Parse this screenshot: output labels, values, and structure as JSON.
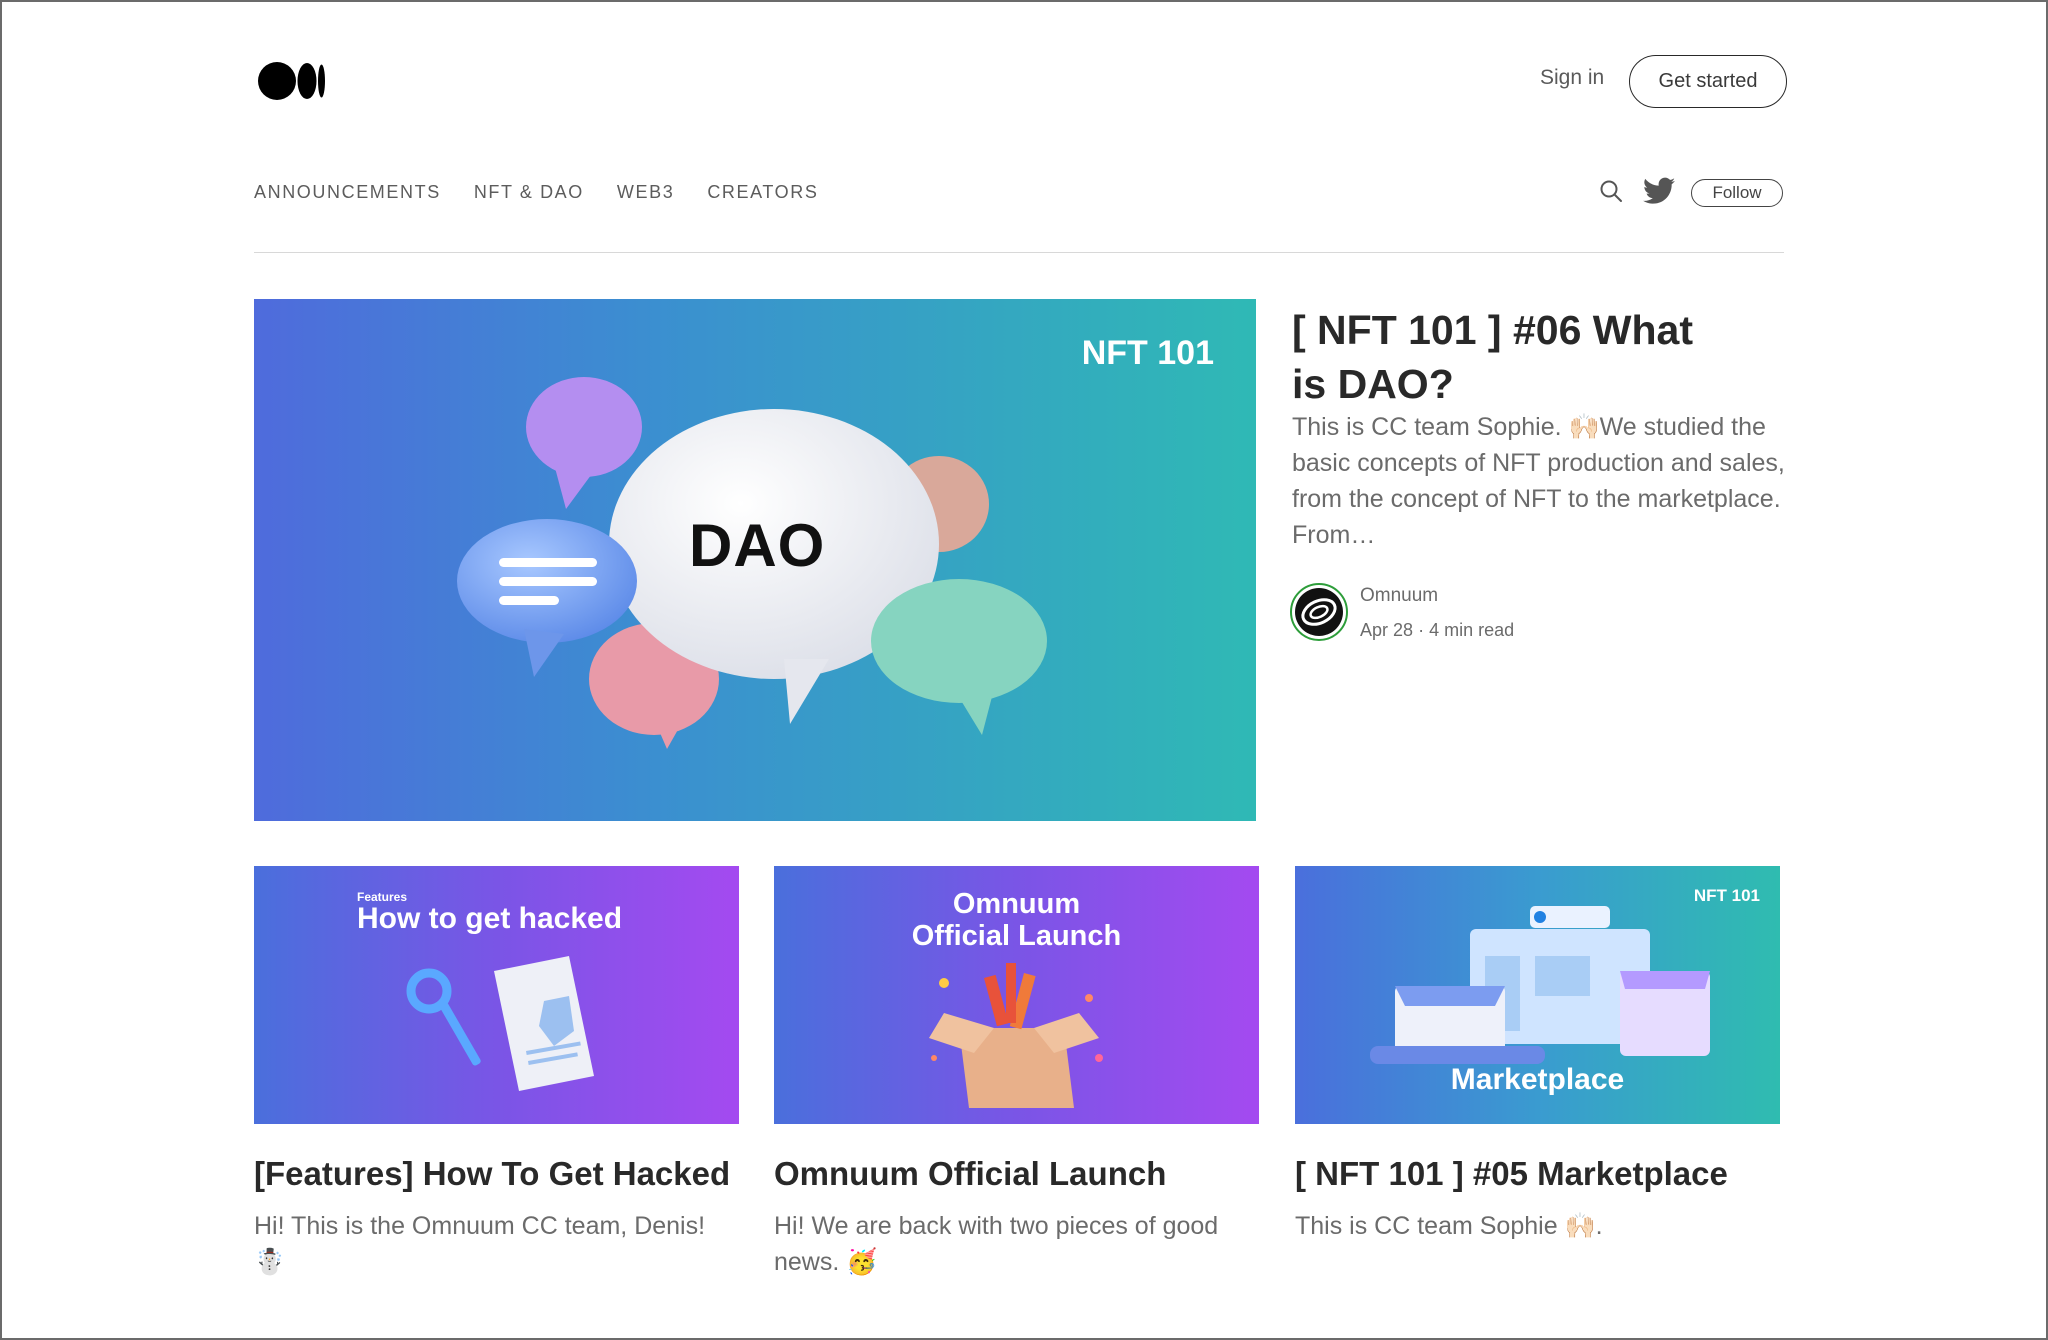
{
  "header": {
    "sign_in": "Sign in",
    "get_started": "Get started"
  },
  "nav": {
    "items": [
      "ANNOUNCEMENTS",
      "NFT & DAO",
      "WEB3",
      "CREATORS"
    ],
    "follow": "Follow"
  },
  "hero": {
    "image_tag": "NFT 101",
    "image_label": "DAO",
    "title": "[ NFT 101 ] #06 What is DAO?",
    "excerpt": "This is CC team Sophie. 🙌🏻We studied the basic concepts of NFT production and sales, from the concept of NFT to the marketplace. From…",
    "author": "Omnuum",
    "date": "Apr 28",
    "read_time": "4 min read"
  },
  "cards": [
    {
      "image_small": "Features",
      "image_text": "How to get hacked",
      "title": "[Features] How To Get Hacked",
      "excerpt": "Hi! This is the Omnuum CC team, Denis! ☃️"
    },
    {
      "image_text_1": "Omnuum",
      "image_text_2": "Official Launch",
      "title": "Omnuum Official Launch",
      "excerpt": "Hi! We are back with two pieces of good news. 🥳"
    },
    {
      "image_tag": "NFT 101",
      "image_text": "Marketplace",
      "title": "[ NFT 101 ] #05 Marketplace",
      "excerpt": "This is CC team Sophie 🙌🏻."
    }
  ],
  "colors": {
    "text": "#292929",
    "muted": "#6b6b6b",
    "avatar_ring": "#2d9d3a"
  }
}
